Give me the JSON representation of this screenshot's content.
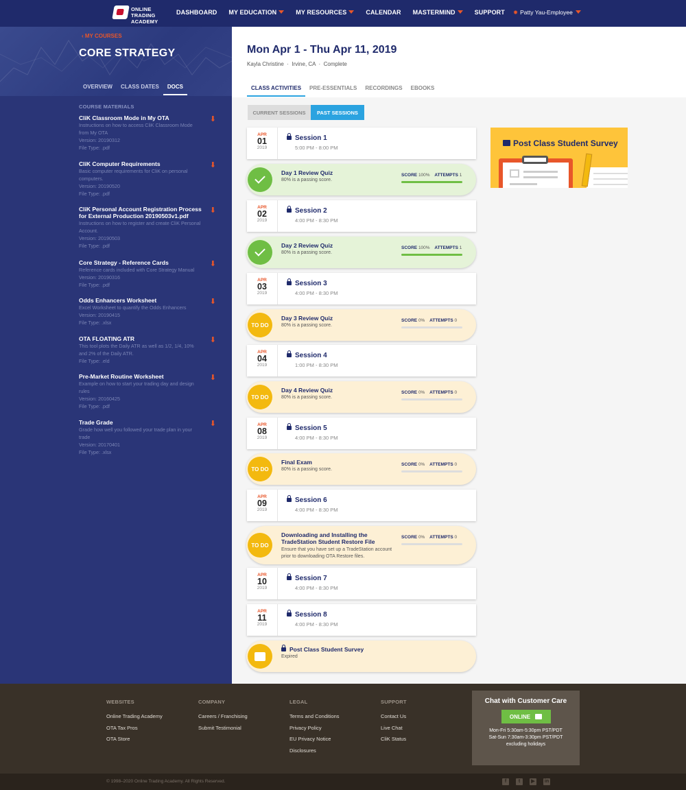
{
  "nav": {
    "logo_text": "ONLINE TRADING ACADEMY",
    "items": [
      {
        "label": "DASHBOARD",
        "dropdown": false
      },
      {
        "label": "MY EDUCATION",
        "dropdown": true
      },
      {
        "label": "MY RESOURCES",
        "dropdown": true
      },
      {
        "label": "CALENDAR",
        "dropdown": false
      },
      {
        "label": "MASTERMIND",
        "dropdown": true
      },
      {
        "label": "SUPPORT",
        "dropdown": false
      }
    ],
    "user": "Patty Yau-Employee"
  },
  "sidebar": {
    "back_label": "MY COURSES",
    "course_title": "CORE STRATEGY",
    "tabs": [
      {
        "label": "OVERVIEW",
        "active": false
      },
      {
        "label": "CLASS DATES",
        "active": false
      },
      {
        "label": "DOCS",
        "active": true
      }
    ],
    "materials_heading": "COURSE MATERIALS",
    "docs": [
      {
        "title": "CliK Classroom Mode in My OTA",
        "desc": [
          "Instructions on how to access CliK Classroom Mode",
          "from My OTA",
          "Version: 20190312",
          "File Type: .pdf"
        ]
      },
      {
        "title": "CliK Computer Requirements",
        "desc": [
          "Basic computer requirements for CliK on personal",
          "computers.",
          "Version: 20190520",
          "File Type: .pdf"
        ]
      },
      {
        "title": "CliK Personal Account Registration Process for External Production 20190503v1.pdf",
        "desc": [
          "Instructions on how to register and create CliK Personal",
          "Account.",
          "Version: 20190503",
          "File Type: .pdf"
        ]
      },
      {
        "title": "Core Strategy - Reference Cards",
        "desc": [
          "Reference cards included with Core Strategy Manual",
          "Version: 20190316",
          "File Type: .pdf"
        ]
      },
      {
        "title": "Odds Enhancers Worksheet",
        "desc": [
          "Excel Worksheet to quantify the Odds Enhancers",
          "Version: 20190415",
          "File Type: .xlsx"
        ]
      },
      {
        "title": "OTA FLOATING ATR",
        "desc": [
          "This tool plots the Daily ATR as well as 1/2, 1/4, 10%",
          "and 2% of the Daily ATR.",
          "File Type: .eld"
        ]
      },
      {
        "title": "Pre-Market Routine Worksheet",
        "desc": [
          "Example on how to start your trading day and design",
          "rules",
          "Version: 20160425",
          "File Type: .pdf"
        ]
      },
      {
        "title": "Trade Grade",
        "desc": [
          "Grade how well you followed your trade plan in your",
          "trade",
          "Version: 20170401",
          "File Type: .xlsx"
        ]
      }
    ]
  },
  "main": {
    "date_range": "Mon Apr 1 - Thu Apr 11, 2019",
    "instructor": "Kayla Christine",
    "location": "Irvine, CA",
    "status": "Complete",
    "tabs": [
      {
        "label": "CLASS ACTIVITIES",
        "active": true
      },
      {
        "label": "PRE-ESSENTIALS",
        "active": false
      },
      {
        "label": "RECORDINGS",
        "active": false
      },
      {
        "label": "EBOOKS",
        "active": false
      }
    ],
    "current_sessions_label": "CURRENT SESSIONS",
    "past_sessions_label": "PAST SESSIONS",
    "items": [
      {
        "kind": "session",
        "mon": "APR",
        "day": "01",
        "year": "2019",
        "title": "Session 1",
        "time": "5:00 PM - 8:00 PM"
      },
      {
        "kind": "quiz",
        "state": "done",
        "title": "Day 1 Review Quiz",
        "sub": "80% is a passing score.",
        "score": "100%",
        "attempts": "1",
        "progress": 1.0
      },
      {
        "kind": "session",
        "mon": "APR",
        "day": "02",
        "year": "2019",
        "title": "Session 2",
        "time": "4:00 PM - 8:30 PM"
      },
      {
        "kind": "quiz",
        "state": "done",
        "title": "Day 2 Review Quiz",
        "sub": "80% is a passing score.",
        "score": "100%",
        "attempts": "1",
        "progress": 1.0
      },
      {
        "kind": "session",
        "mon": "APR",
        "day": "03",
        "year": "2019",
        "title": "Session 3",
        "time": "4:00 PM - 8:30 PM"
      },
      {
        "kind": "quiz",
        "state": "todo",
        "badge": "TO DO",
        "title": "Day 3 Review Quiz",
        "sub": "80% is a passing score.",
        "score": "0%",
        "attempts": "0",
        "progress": 0
      },
      {
        "kind": "session",
        "mon": "APR",
        "day": "04",
        "year": "2019",
        "title": "Session 4",
        "time": "1:00 PM - 8:30 PM"
      },
      {
        "kind": "quiz",
        "state": "todo",
        "badge": "TO DO",
        "title": "Day 4 Review Quiz",
        "sub": "80% is a passing score.",
        "score": "0%",
        "attempts": "0",
        "progress": 0
      },
      {
        "kind": "session",
        "mon": "APR",
        "day": "08",
        "year": "2019",
        "title": "Session 5",
        "time": "4:00 PM - 8:30 PM"
      },
      {
        "kind": "quiz",
        "state": "todo",
        "badge": "TO DO",
        "title": "Final Exam",
        "sub": "80% is a passing score.",
        "score": "0%",
        "attempts": "0",
        "progress": 0
      },
      {
        "kind": "session",
        "mon": "APR",
        "day": "09",
        "year": "2019",
        "title": "Session 6",
        "time": "4:00 PM - 8:30 PM"
      },
      {
        "kind": "quiz",
        "state": "todo",
        "badge": "TO DO",
        "title": "Downloading and Installing the TradeStation Student Restore File",
        "sub": "Ensure that you have set up a TradeStation account prior to downloading OTA Restore files.",
        "score": "0%",
        "attempts": "0",
        "progress": 0
      },
      {
        "kind": "session",
        "mon": "APR",
        "day": "10",
        "year": "2019",
        "title": "Session 7",
        "time": "4:00 PM - 8:30 PM"
      },
      {
        "kind": "session",
        "mon": "APR",
        "day": "11",
        "year": "2019",
        "title": "Session 8",
        "time": "4:00 PM - 8:30 PM"
      },
      {
        "kind": "survey",
        "state": "todo",
        "title": "Post Class Student Survey",
        "sub": "Expired"
      }
    ],
    "score_label": "SCORE",
    "attempts_label": "ATTEMPTS",
    "survey_banner": "Post Class Student Survey"
  },
  "footer": {
    "columns": [
      {
        "heading": "WEBSITES",
        "links": [
          "Online Trading Academy",
          "OTA Tax Pros",
          "OTA Store"
        ]
      },
      {
        "heading": "COMPANY",
        "links": [
          "Careers / Franchising",
          "Submit Testimonial"
        ]
      },
      {
        "heading": "LEGAL",
        "links": [
          "Terms and Conditions",
          "Privacy Policy",
          "EU Privacy Notice",
          "Disclosures"
        ]
      },
      {
        "heading": "SUPPORT",
        "links": [
          "Contact Us",
          "Live Chat",
          "CliK Status"
        ]
      }
    ],
    "chat": {
      "title": "Chat with Customer Care",
      "button": "ONLINE",
      "hours": [
        "Mon-Fri 5:30am-5:30pm PST/PDT",
        "Sat-Sun 7:30am-3:30pm PST/PDT",
        "excluding holidays"
      ]
    },
    "copyright": "© 1998–2020 Online Trading Academy. All Rights Reserved.",
    "social": [
      {
        "icon": "facebook-icon",
        "glyph": "f"
      },
      {
        "icon": "twitter-icon",
        "glyph": "t"
      },
      {
        "icon": "youtube-icon",
        "glyph": "▶"
      },
      {
        "icon": "linkedin-icon",
        "glyph": "in"
      }
    ]
  },
  "colors": {
    "navy": "#1f2a6b",
    "accent_orange": "#e8562a",
    "blue": "#2ba3e0",
    "green": "#6fbe44",
    "yellow": "#f3b90f"
  }
}
